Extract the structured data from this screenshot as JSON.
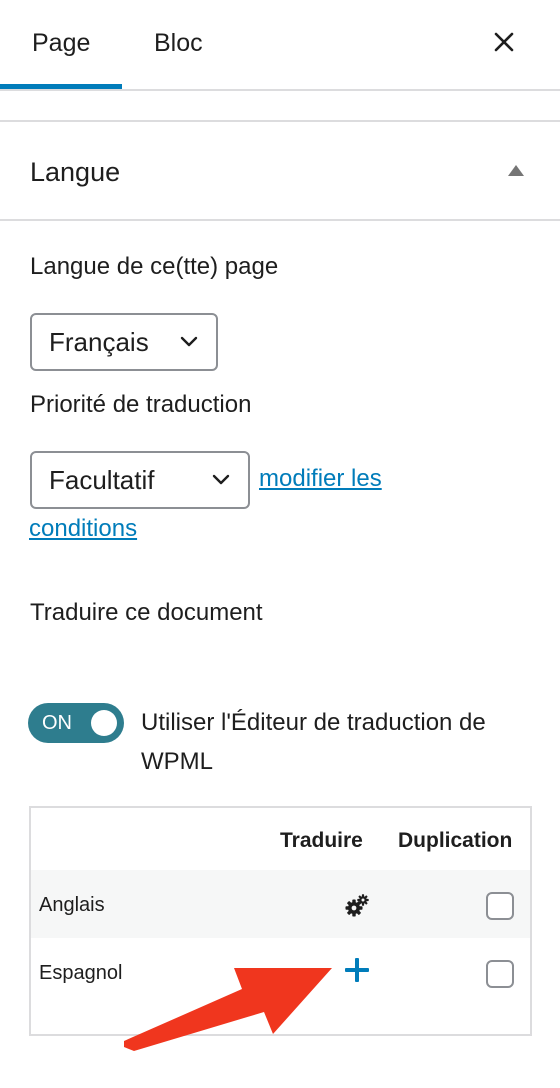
{
  "tabs": [
    {
      "label": "Page"
    },
    {
      "label": "Bloc"
    }
  ],
  "panel": {
    "title": "Langue"
  },
  "language_field": {
    "label": "Langue de ce(tte) page",
    "selected": "Français"
  },
  "priority_field": {
    "label": "Priorité de traduction",
    "selected": "Facultatif",
    "link_part1": "modifier les",
    "link_part2": "conditions"
  },
  "translate_section": {
    "label": "Traduire ce document",
    "toggle_state": "ON",
    "toggle_on": true,
    "toggle_desc": "Utiliser l'Éditeur de traduction de WPML"
  },
  "table": {
    "headers": {
      "translate": "Traduire",
      "duplication": "Duplication"
    },
    "rows": [
      {
        "language": "Anglais",
        "action_icon": "gears-icon",
        "duplicated": false
      },
      {
        "language": "Espagnol",
        "action_icon": "plus-icon",
        "duplicated": false
      }
    ]
  },
  "colors": {
    "accent": "#007cba",
    "toggle_bg": "#2e7d8e",
    "annotation_arrow": "#f0361e"
  }
}
